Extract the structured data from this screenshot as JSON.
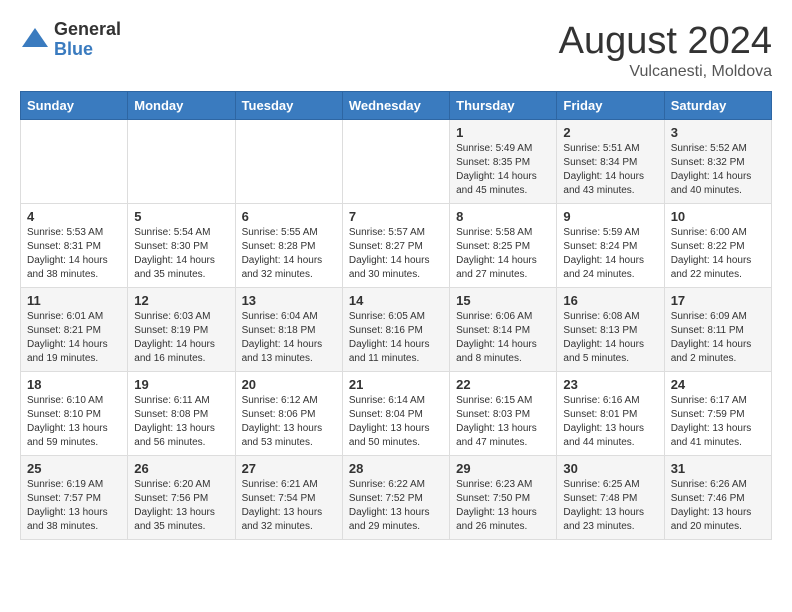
{
  "logo": {
    "general": "General",
    "blue": "Blue"
  },
  "title": "August 2024",
  "subtitle": "Vulcanesti, Moldova",
  "days_of_week": [
    "Sunday",
    "Monday",
    "Tuesday",
    "Wednesday",
    "Thursday",
    "Friday",
    "Saturday"
  ],
  "weeks": [
    [
      {
        "day": "",
        "info": ""
      },
      {
        "day": "",
        "info": ""
      },
      {
        "day": "",
        "info": ""
      },
      {
        "day": "",
        "info": ""
      },
      {
        "day": "1",
        "info": "Sunrise: 5:49 AM\nSunset: 8:35 PM\nDaylight: 14 hours\nand 45 minutes."
      },
      {
        "day": "2",
        "info": "Sunrise: 5:51 AM\nSunset: 8:34 PM\nDaylight: 14 hours\nand 43 minutes."
      },
      {
        "day": "3",
        "info": "Sunrise: 5:52 AM\nSunset: 8:32 PM\nDaylight: 14 hours\nand 40 minutes."
      }
    ],
    [
      {
        "day": "4",
        "info": "Sunrise: 5:53 AM\nSunset: 8:31 PM\nDaylight: 14 hours\nand 38 minutes."
      },
      {
        "day": "5",
        "info": "Sunrise: 5:54 AM\nSunset: 8:30 PM\nDaylight: 14 hours\nand 35 minutes."
      },
      {
        "day": "6",
        "info": "Sunrise: 5:55 AM\nSunset: 8:28 PM\nDaylight: 14 hours\nand 32 minutes."
      },
      {
        "day": "7",
        "info": "Sunrise: 5:57 AM\nSunset: 8:27 PM\nDaylight: 14 hours\nand 30 minutes."
      },
      {
        "day": "8",
        "info": "Sunrise: 5:58 AM\nSunset: 8:25 PM\nDaylight: 14 hours\nand 27 minutes."
      },
      {
        "day": "9",
        "info": "Sunrise: 5:59 AM\nSunset: 8:24 PM\nDaylight: 14 hours\nand 24 minutes."
      },
      {
        "day": "10",
        "info": "Sunrise: 6:00 AM\nSunset: 8:22 PM\nDaylight: 14 hours\nand 22 minutes."
      }
    ],
    [
      {
        "day": "11",
        "info": "Sunrise: 6:01 AM\nSunset: 8:21 PM\nDaylight: 14 hours\nand 19 minutes."
      },
      {
        "day": "12",
        "info": "Sunrise: 6:03 AM\nSunset: 8:19 PM\nDaylight: 14 hours\nand 16 minutes."
      },
      {
        "day": "13",
        "info": "Sunrise: 6:04 AM\nSunset: 8:18 PM\nDaylight: 14 hours\nand 13 minutes."
      },
      {
        "day": "14",
        "info": "Sunrise: 6:05 AM\nSunset: 8:16 PM\nDaylight: 14 hours\nand 11 minutes."
      },
      {
        "day": "15",
        "info": "Sunrise: 6:06 AM\nSunset: 8:14 PM\nDaylight: 14 hours\nand 8 minutes."
      },
      {
        "day": "16",
        "info": "Sunrise: 6:08 AM\nSunset: 8:13 PM\nDaylight: 14 hours\nand 5 minutes."
      },
      {
        "day": "17",
        "info": "Sunrise: 6:09 AM\nSunset: 8:11 PM\nDaylight: 14 hours\nand 2 minutes."
      }
    ],
    [
      {
        "day": "18",
        "info": "Sunrise: 6:10 AM\nSunset: 8:10 PM\nDaylight: 13 hours\nand 59 minutes."
      },
      {
        "day": "19",
        "info": "Sunrise: 6:11 AM\nSunset: 8:08 PM\nDaylight: 13 hours\nand 56 minutes."
      },
      {
        "day": "20",
        "info": "Sunrise: 6:12 AM\nSunset: 8:06 PM\nDaylight: 13 hours\nand 53 minutes."
      },
      {
        "day": "21",
        "info": "Sunrise: 6:14 AM\nSunset: 8:04 PM\nDaylight: 13 hours\nand 50 minutes."
      },
      {
        "day": "22",
        "info": "Sunrise: 6:15 AM\nSunset: 8:03 PM\nDaylight: 13 hours\nand 47 minutes."
      },
      {
        "day": "23",
        "info": "Sunrise: 6:16 AM\nSunset: 8:01 PM\nDaylight: 13 hours\nand 44 minutes."
      },
      {
        "day": "24",
        "info": "Sunrise: 6:17 AM\nSunset: 7:59 PM\nDaylight: 13 hours\nand 41 minutes."
      }
    ],
    [
      {
        "day": "25",
        "info": "Sunrise: 6:19 AM\nSunset: 7:57 PM\nDaylight: 13 hours\nand 38 minutes."
      },
      {
        "day": "26",
        "info": "Sunrise: 6:20 AM\nSunset: 7:56 PM\nDaylight: 13 hours\nand 35 minutes."
      },
      {
        "day": "27",
        "info": "Sunrise: 6:21 AM\nSunset: 7:54 PM\nDaylight: 13 hours\nand 32 minutes."
      },
      {
        "day": "28",
        "info": "Sunrise: 6:22 AM\nSunset: 7:52 PM\nDaylight: 13 hours\nand 29 minutes."
      },
      {
        "day": "29",
        "info": "Sunrise: 6:23 AM\nSunset: 7:50 PM\nDaylight: 13 hours\nand 26 minutes."
      },
      {
        "day": "30",
        "info": "Sunrise: 6:25 AM\nSunset: 7:48 PM\nDaylight: 13 hours\nand 23 minutes."
      },
      {
        "day": "31",
        "info": "Sunrise: 6:26 AM\nSunset: 7:46 PM\nDaylight: 13 hours\nand 20 minutes."
      }
    ]
  ]
}
